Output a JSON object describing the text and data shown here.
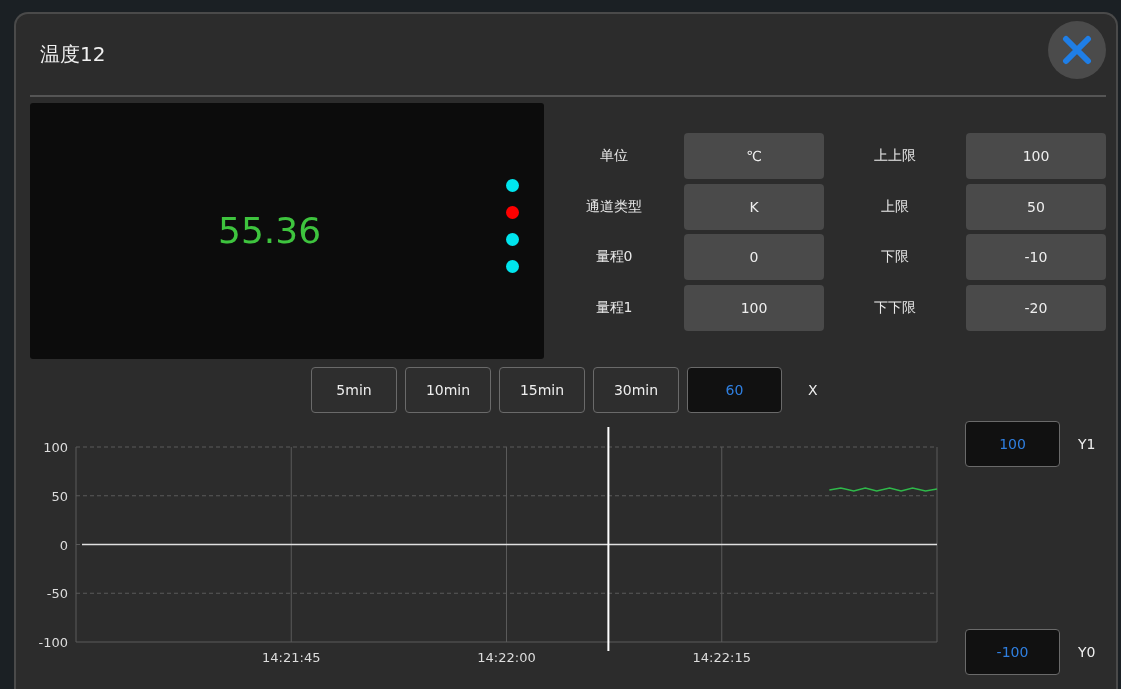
{
  "dialog": {
    "title": "温度12"
  },
  "display": {
    "value": "55.36",
    "indicators": [
      {
        "color": "#00e5ee"
      },
      {
        "color": "#ff0000"
      },
      {
        "color": "#00e5ee"
      },
      {
        "color": "#00e5ee"
      }
    ]
  },
  "parameters": [
    {
      "label": "单位",
      "value": "℃"
    },
    {
      "label": "上上限",
      "value": "100"
    },
    {
      "label": "通道类型",
      "value": "K"
    },
    {
      "label": "上限",
      "value": "50"
    },
    {
      "label": "量程0",
      "value": "0"
    },
    {
      "label": "下限",
      "value": "-10"
    },
    {
      "label": "量程1",
      "value": "100"
    },
    {
      "label": "下下限",
      "value": "-20"
    }
  ],
  "time_buttons": [
    {
      "label": "5min"
    },
    {
      "label": "10min"
    },
    {
      "label": "15min"
    },
    {
      "label": "30min"
    }
  ],
  "x_range": {
    "value": "60",
    "label": "X"
  },
  "y_max": {
    "value": "100",
    "label": "Y1"
  },
  "y_min": {
    "value": "-100",
    "label": "Y0"
  },
  "chart_data": {
    "type": "line",
    "xlim": [
      51690,
      51750
    ],
    "ylim": [
      -100,
      100
    ],
    "yticks": [
      100,
      50,
      0,
      -50,
      -100
    ],
    "xticks": [
      {
        "value": 51705,
        "label": "14:21:45"
      },
      {
        "value": 51720,
        "label": "14:22:00"
      },
      {
        "value": 51735,
        "label": "14:22:15"
      }
    ],
    "x": [
      51742.5,
      51743.3,
      51744.2,
      51745,
      51745.8,
      51746.7,
      51747.5,
      51748.3,
      51749.2,
      51750
    ],
    "series": [
      {
        "color": "#2fb84a",
        "values": [
          56,
          58,
          55,
          58,
          55,
          58,
          55,
          58,
          55,
          57
        ]
      }
    ],
    "grid": true,
    "ref_lines": [
      {
        "axis": "y",
        "value": 0
      },
      {
        "axis": "x",
        "value": 51727.1
      }
    ]
  }
}
